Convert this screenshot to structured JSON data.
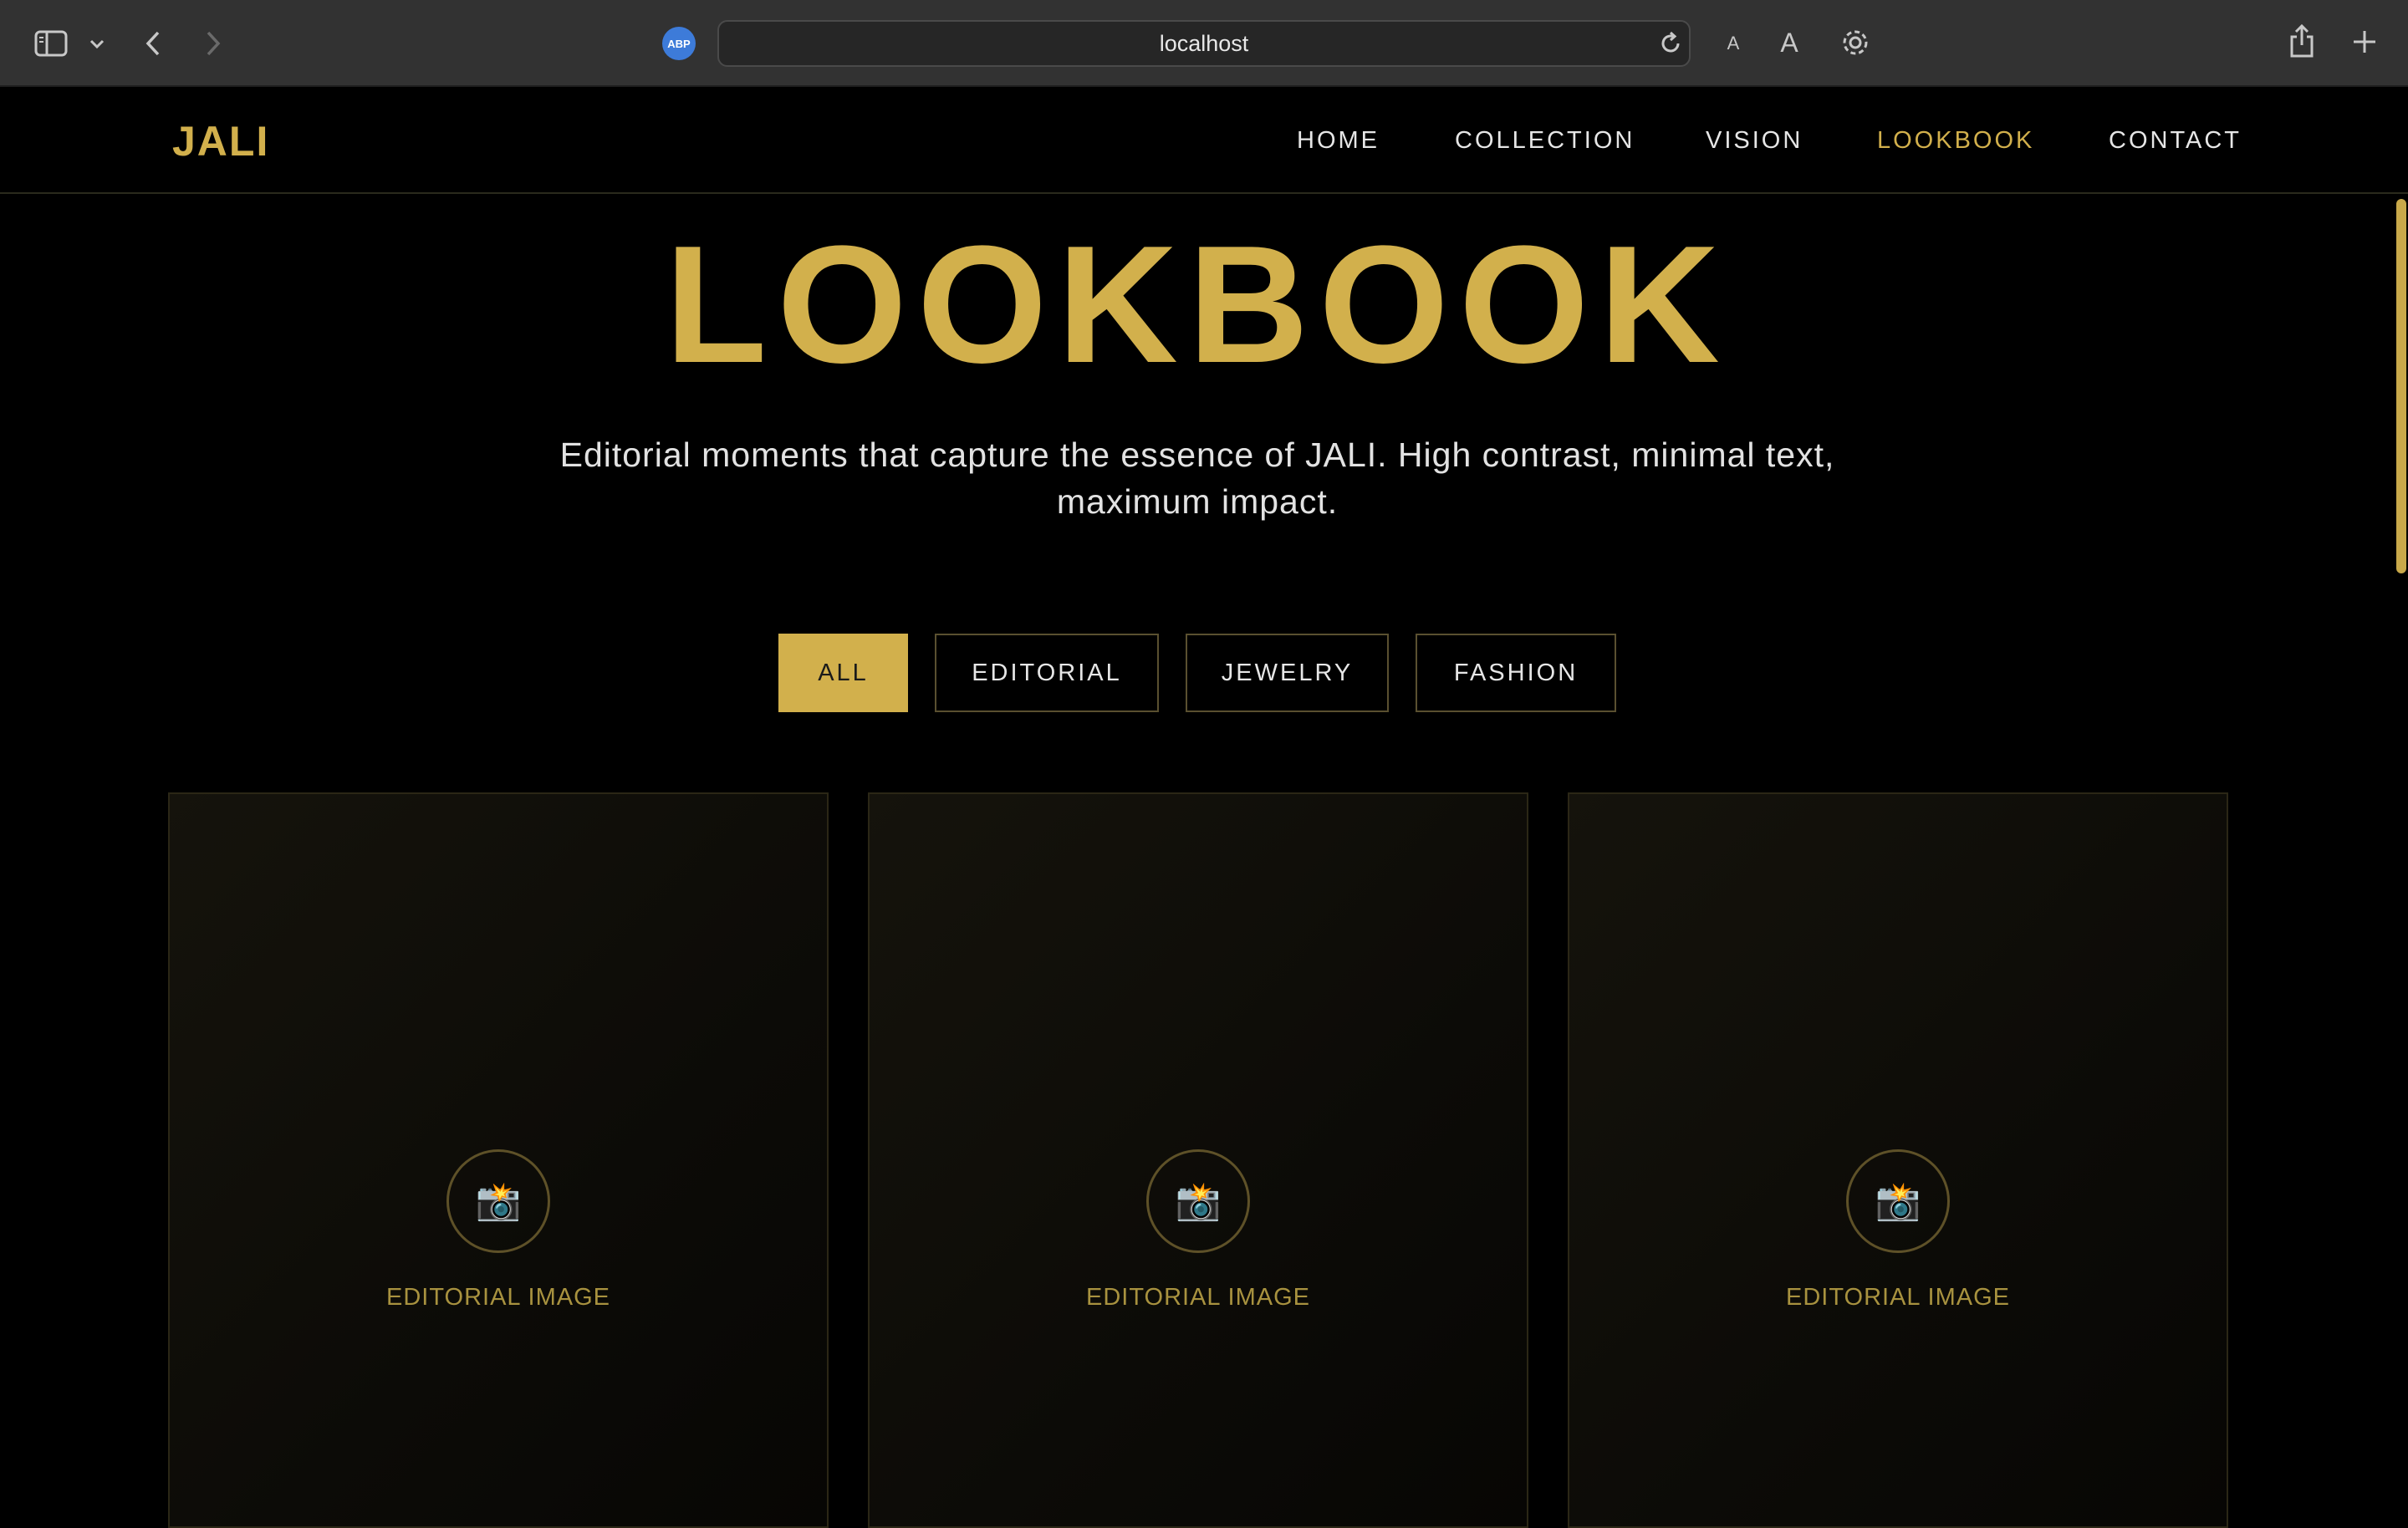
{
  "browser": {
    "url": "localhost",
    "abp_label": "ABP",
    "font_small_label": "A",
    "font_large_label": "A"
  },
  "site": {
    "logo": "JALI",
    "nav": [
      {
        "label": "HOME",
        "active": false
      },
      {
        "label": "COLLECTION",
        "active": false
      },
      {
        "label": "VISION",
        "active": false
      },
      {
        "label": "LOOKBOOK",
        "active": true
      },
      {
        "label": "CONTACT",
        "active": false
      }
    ]
  },
  "hero": {
    "title": "LOOKBOOK",
    "subtitle": "Editorial moments that capture the essence of JALI. High contrast, minimal text, maximum impact."
  },
  "filters": [
    {
      "label": "ALL",
      "active": true
    },
    {
      "label": "EDITORIAL",
      "active": false
    },
    {
      "label": "JEWELRY",
      "active": false
    },
    {
      "label": "FASHION",
      "active": false
    }
  ],
  "gallery": [
    {
      "icon": "camera-flash-icon",
      "label": "EDITORIAL IMAGE"
    },
    {
      "icon": "camera-flash-icon",
      "label": "EDITORIAL IMAGE"
    },
    {
      "icon": "camera-flash-icon",
      "label": "EDITORIAL IMAGE"
    }
  ],
  "colors": {
    "accent": "#d2b04c",
    "background": "#000000",
    "chrome": "#323232"
  }
}
